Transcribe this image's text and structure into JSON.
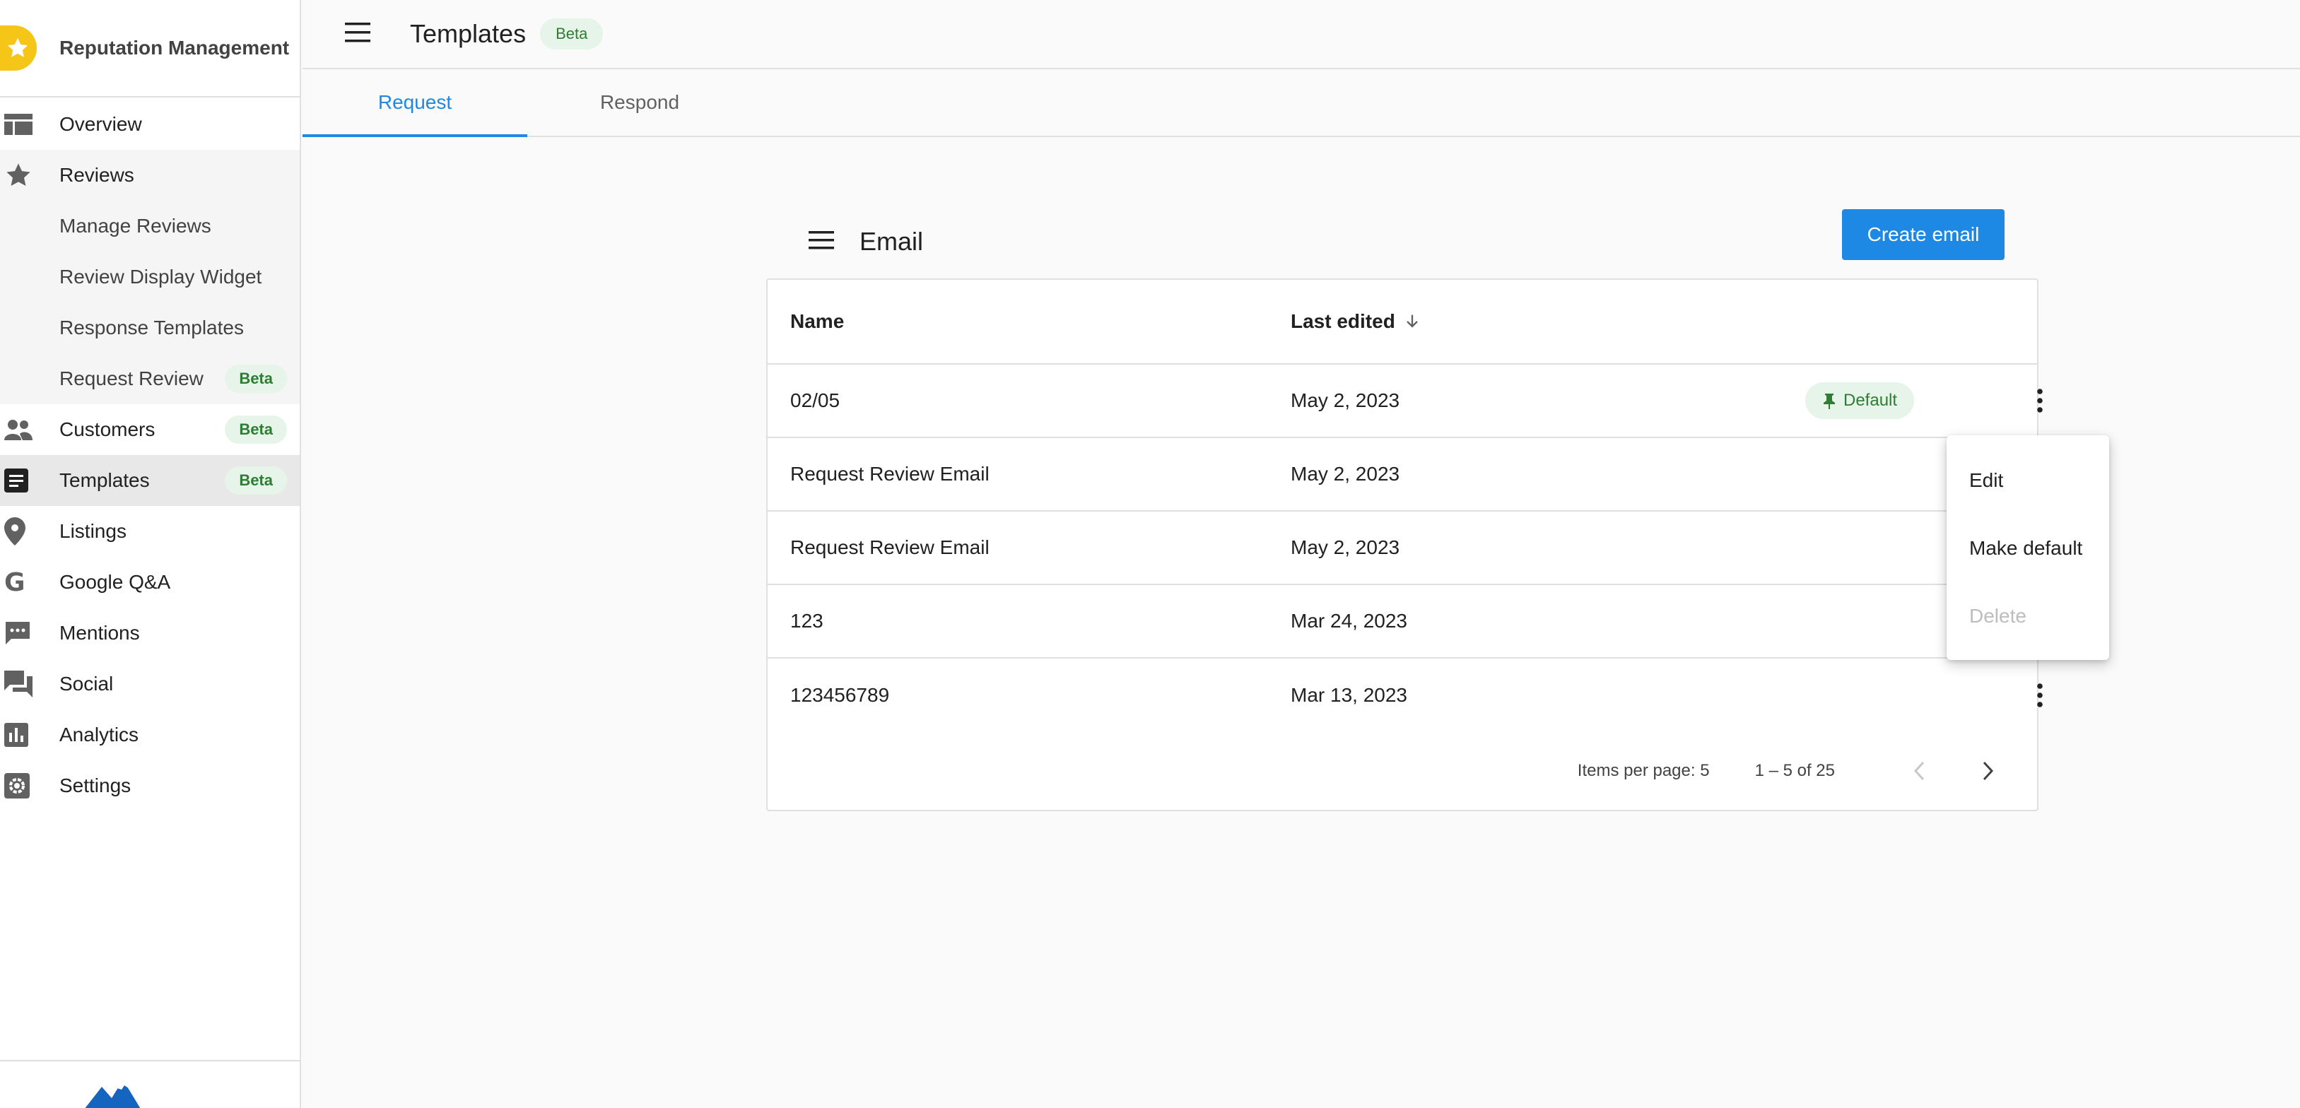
{
  "app": {
    "title": "Reputation Management",
    "accent": "#1e88e5",
    "brand_color": "#f5c518"
  },
  "sidebar": {
    "items": [
      {
        "label": "Overview",
        "icon": "dashboard-icon"
      },
      {
        "label": "Reviews",
        "icon": "star-icon"
      },
      {
        "label": "Manage Reviews"
      },
      {
        "label": "Review Display Widget"
      },
      {
        "label": "Response Templates"
      },
      {
        "label": "Request Review",
        "badge": "Beta"
      },
      {
        "label": "Customers",
        "icon": "people-icon",
        "badge": "Beta"
      },
      {
        "label": "Templates",
        "icon": "document-icon",
        "badge": "Beta",
        "active": true
      },
      {
        "label": "Listings",
        "icon": "location-pin-icon"
      },
      {
        "label": "Google Q&A",
        "icon": "google-g-icon"
      },
      {
        "label": "Mentions",
        "icon": "comment-icon"
      },
      {
        "label": "Social",
        "icon": "forum-icon"
      },
      {
        "label": "Analytics",
        "icon": "bar-chart-icon"
      },
      {
        "label": "Settings",
        "icon": "gear-icon"
      }
    ]
  },
  "header": {
    "title": "Templates",
    "badge": "Beta"
  },
  "tabs": [
    {
      "label": "Request",
      "active": true
    },
    {
      "label": "Respond",
      "active": false
    }
  ],
  "card": {
    "title": "Email",
    "create_button": "Create email"
  },
  "table": {
    "columns": {
      "name": "Name",
      "last_edited": "Last edited"
    },
    "sort": "last_edited descending",
    "rows": [
      {
        "name": "02/05",
        "last_edited": "May 2, 2023",
        "chip": "Default"
      },
      {
        "name": "Request Review Email",
        "last_edited": "May 2, 2023"
      },
      {
        "name": "Request Review Email",
        "last_edited": "May 2, 2023"
      },
      {
        "name": "123",
        "last_edited": "Mar 24, 2023"
      },
      {
        "name": "123456789",
        "last_edited": "Mar 13, 2023"
      }
    ]
  },
  "paginator": {
    "items_per_page_label": "Items per page: 5",
    "range_label": "1 – 5 of 25"
  },
  "row_menu": {
    "items": [
      {
        "label": "Edit",
        "enabled": true
      },
      {
        "label": "Make default",
        "enabled": true
      },
      {
        "label": "Delete",
        "enabled": false
      }
    ]
  }
}
